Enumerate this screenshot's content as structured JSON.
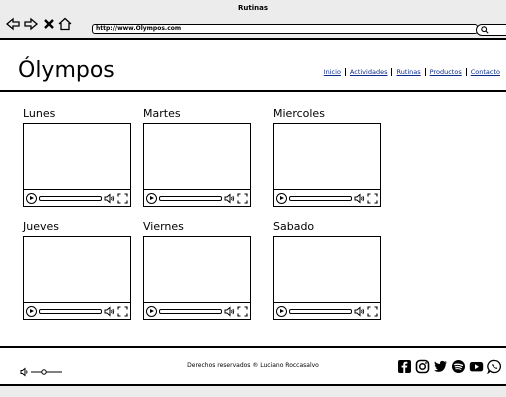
{
  "browser": {
    "window_title": "Rutinas",
    "url": "http://www.Olympos.com"
  },
  "header": {
    "brand": "Ólympos",
    "nav": [
      "Inicio",
      "Actividades",
      "Rutinas",
      "Productos",
      "Contacto"
    ]
  },
  "days": [
    {
      "label": "Lunes"
    },
    {
      "label": "Martes"
    },
    {
      "label": "Miercoles"
    },
    {
      "label": "Jueves"
    },
    {
      "label": "Viernes"
    },
    {
      "label": "Sabado"
    }
  ],
  "footer": {
    "copyright": "Derechos reservados ® Luciano Roccasalvo",
    "social_icons": [
      "facebook-icon",
      "instagram-icon",
      "twitter-icon",
      "spotify-icon",
      "youtube-icon",
      "whatsapp-icon"
    ]
  }
}
